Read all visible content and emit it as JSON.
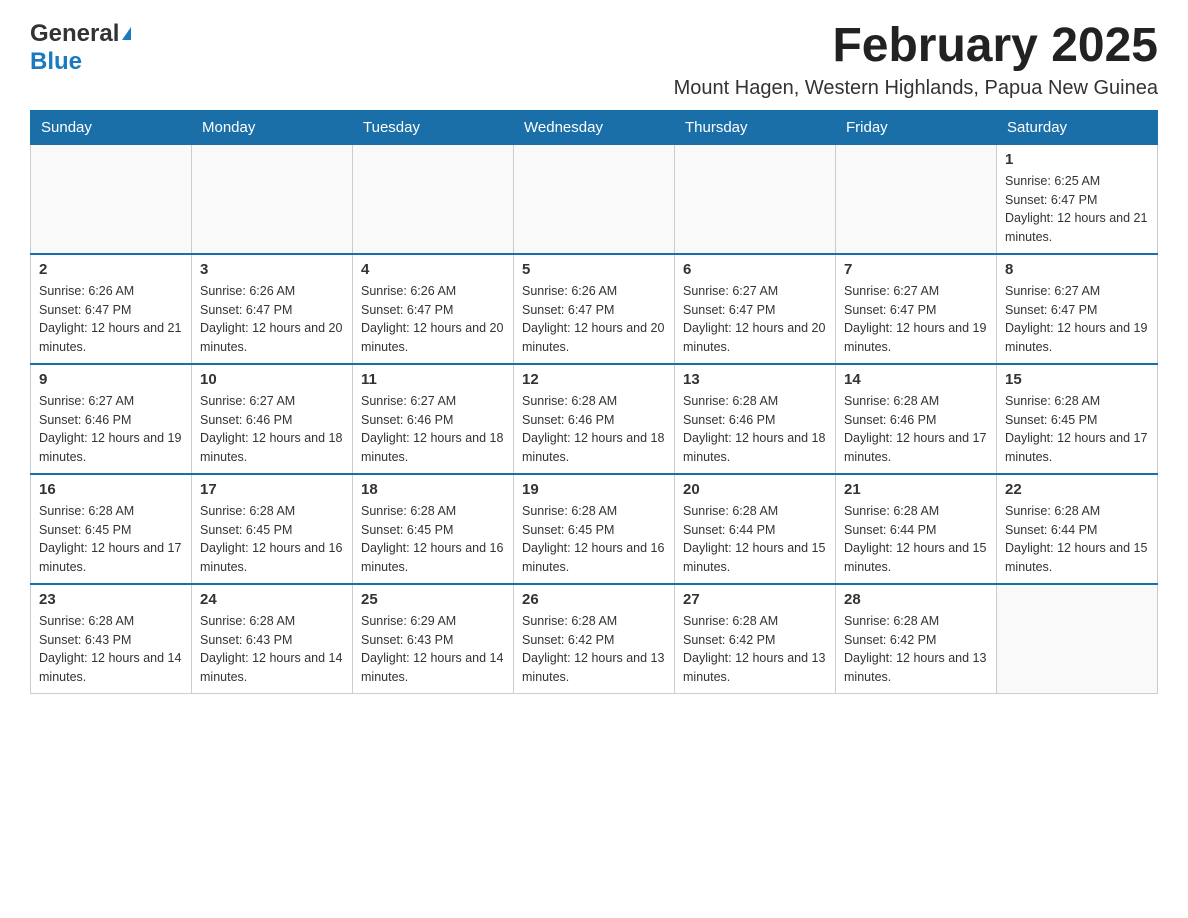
{
  "header": {
    "logo_general": "General",
    "logo_blue": "Blue",
    "month_title": "February 2025",
    "location": "Mount Hagen, Western Highlands, Papua New Guinea"
  },
  "days_of_week": [
    "Sunday",
    "Monday",
    "Tuesday",
    "Wednesday",
    "Thursday",
    "Friday",
    "Saturday"
  ],
  "weeks": [
    {
      "cells": [
        {
          "day": "",
          "info": ""
        },
        {
          "day": "",
          "info": ""
        },
        {
          "day": "",
          "info": ""
        },
        {
          "day": "",
          "info": ""
        },
        {
          "day": "",
          "info": ""
        },
        {
          "day": "",
          "info": ""
        },
        {
          "day": "1",
          "info": "Sunrise: 6:25 AM\nSunset: 6:47 PM\nDaylight: 12 hours and 21 minutes."
        }
      ]
    },
    {
      "cells": [
        {
          "day": "2",
          "info": "Sunrise: 6:26 AM\nSunset: 6:47 PM\nDaylight: 12 hours and 21 minutes."
        },
        {
          "day": "3",
          "info": "Sunrise: 6:26 AM\nSunset: 6:47 PM\nDaylight: 12 hours and 20 minutes."
        },
        {
          "day": "4",
          "info": "Sunrise: 6:26 AM\nSunset: 6:47 PM\nDaylight: 12 hours and 20 minutes."
        },
        {
          "day": "5",
          "info": "Sunrise: 6:26 AM\nSunset: 6:47 PM\nDaylight: 12 hours and 20 minutes."
        },
        {
          "day": "6",
          "info": "Sunrise: 6:27 AM\nSunset: 6:47 PM\nDaylight: 12 hours and 20 minutes."
        },
        {
          "day": "7",
          "info": "Sunrise: 6:27 AM\nSunset: 6:47 PM\nDaylight: 12 hours and 19 minutes."
        },
        {
          "day": "8",
          "info": "Sunrise: 6:27 AM\nSunset: 6:47 PM\nDaylight: 12 hours and 19 minutes."
        }
      ]
    },
    {
      "cells": [
        {
          "day": "9",
          "info": "Sunrise: 6:27 AM\nSunset: 6:46 PM\nDaylight: 12 hours and 19 minutes."
        },
        {
          "day": "10",
          "info": "Sunrise: 6:27 AM\nSunset: 6:46 PM\nDaylight: 12 hours and 18 minutes."
        },
        {
          "day": "11",
          "info": "Sunrise: 6:27 AM\nSunset: 6:46 PM\nDaylight: 12 hours and 18 minutes."
        },
        {
          "day": "12",
          "info": "Sunrise: 6:28 AM\nSunset: 6:46 PM\nDaylight: 12 hours and 18 minutes."
        },
        {
          "day": "13",
          "info": "Sunrise: 6:28 AM\nSunset: 6:46 PM\nDaylight: 12 hours and 18 minutes."
        },
        {
          "day": "14",
          "info": "Sunrise: 6:28 AM\nSunset: 6:46 PM\nDaylight: 12 hours and 17 minutes."
        },
        {
          "day": "15",
          "info": "Sunrise: 6:28 AM\nSunset: 6:45 PM\nDaylight: 12 hours and 17 minutes."
        }
      ]
    },
    {
      "cells": [
        {
          "day": "16",
          "info": "Sunrise: 6:28 AM\nSunset: 6:45 PM\nDaylight: 12 hours and 17 minutes."
        },
        {
          "day": "17",
          "info": "Sunrise: 6:28 AM\nSunset: 6:45 PM\nDaylight: 12 hours and 16 minutes."
        },
        {
          "day": "18",
          "info": "Sunrise: 6:28 AM\nSunset: 6:45 PM\nDaylight: 12 hours and 16 minutes."
        },
        {
          "day": "19",
          "info": "Sunrise: 6:28 AM\nSunset: 6:45 PM\nDaylight: 12 hours and 16 minutes."
        },
        {
          "day": "20",
          "info": "Sunrise: 6:28 AM\nSunset: 6:44 PM\nDaylight: 12 hours and 15 minutes."
        },
        {
          "day": "21",
          "info": "Sunrise: 6:28 AM\nSunset: 6:44 PM\nDaylight: 12 hours and 15 minutes."
        },
        {
          "day": "22",
          "info": "Sunrise: 6:28 AM\nSunset: 6:44 PM\nDaylight: 12 hours and 15 minutes."
        }
      ]
    },
    {
      "cells": [
        {
          "day": "23",
          "info": "Sunrise: 6:28 AM\nSunset: 6:43 PM\nDaylight: 12 hours and 14 minutes."
        },
        {
          "day": "24",
          "info": "Sunrise: 6:28 AM\nSunset: 6:43 PM\nDaylight: 12 hours and 14 minutes."
        },
        {
          "day": "25",
          "info": "Sunrise: 6:29 AM\nSunset: 6:43 PM\nDaylight: 12 hours and 14 minutes."
        },
        {
          "day": "26",
          "info": "Sunrise: 6:28 AM\nSunset: 6:42 PM\nDaylight: 12 hours and 13 minutes."
        },
        {
          "day": "27",
          "info": "Sunrise: 6:28 AM\nSunset: 6:42 PM\nDaylight: 12 hours and 13 minutes."
        },
        {
          "day": "28",
          "info": "Sunrise: 6:28 AM\nSunset: 6:42 PM\nDaylight: 12 hours and 13 minutes."
        },
        {
          "day": "",
          "info": ""
        }
      ]
    }
  ]
}
